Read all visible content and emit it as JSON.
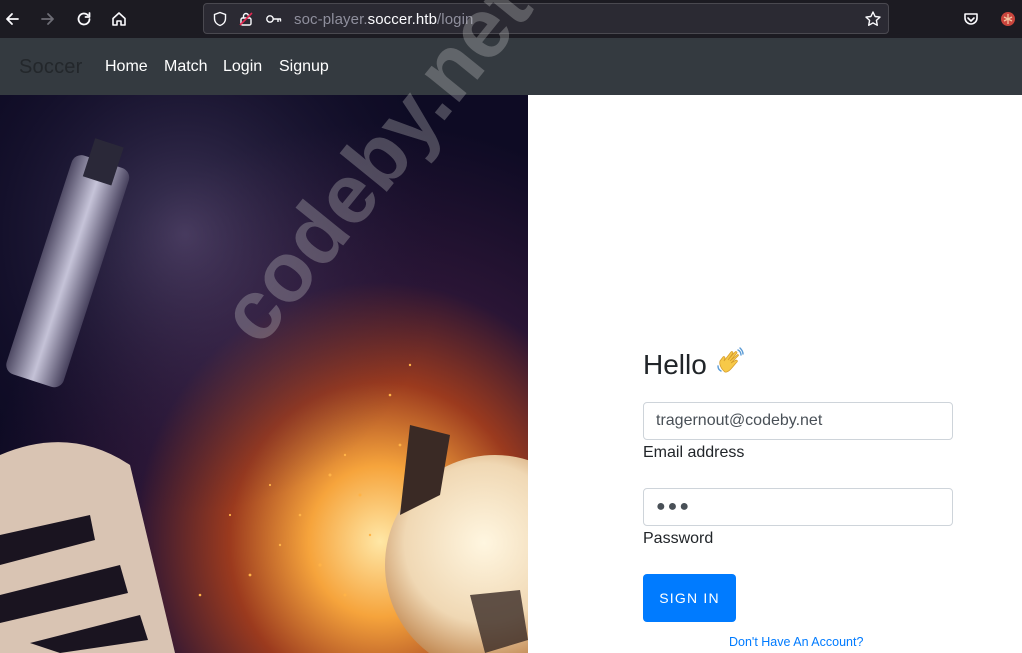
{
  "browser": {
    "url_prefix": "soc-player.",
    "url_host": "soccer.htb",
    "url_path": "/login"
  },
  "navbar": {
    "brand": "Soccer",
    "links": [
      "Home",
      "Match",
      "Login",
      "Signup"
    ]
  },
  "login": {
    "greeting": "Hello",
    "email_value": "tragernout@codeby.net",
    "email_label": "Email address",
    "password_mask": "●●●",
    "password_label": "Password",
    "signin_label": "SIGN IN",
    "signup_link": "Don't Have An Account?"
  },
  "watermark": "codeby.net",
  "colors": {
    "toolbar_bg": "#1c1b22",
    "navbar_bg": "#343a40",
    "accent": "#007bff"
  }
}
